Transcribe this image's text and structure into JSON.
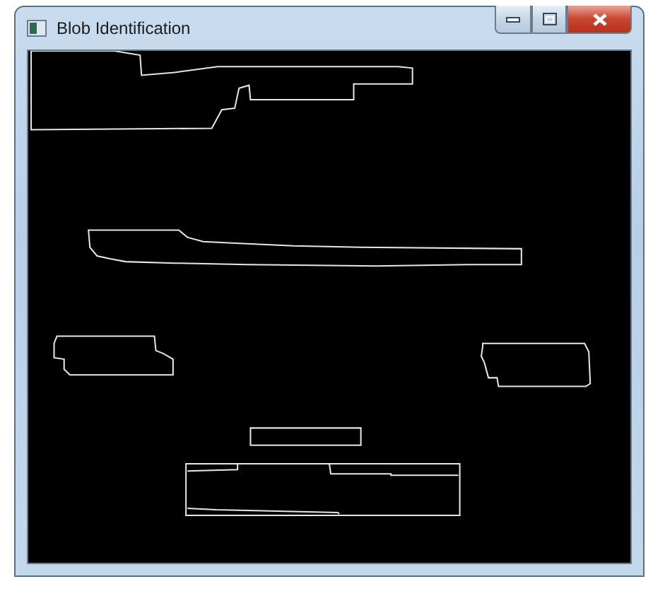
{
  "window": {
    "title": "Blob Identification"
  }
}
